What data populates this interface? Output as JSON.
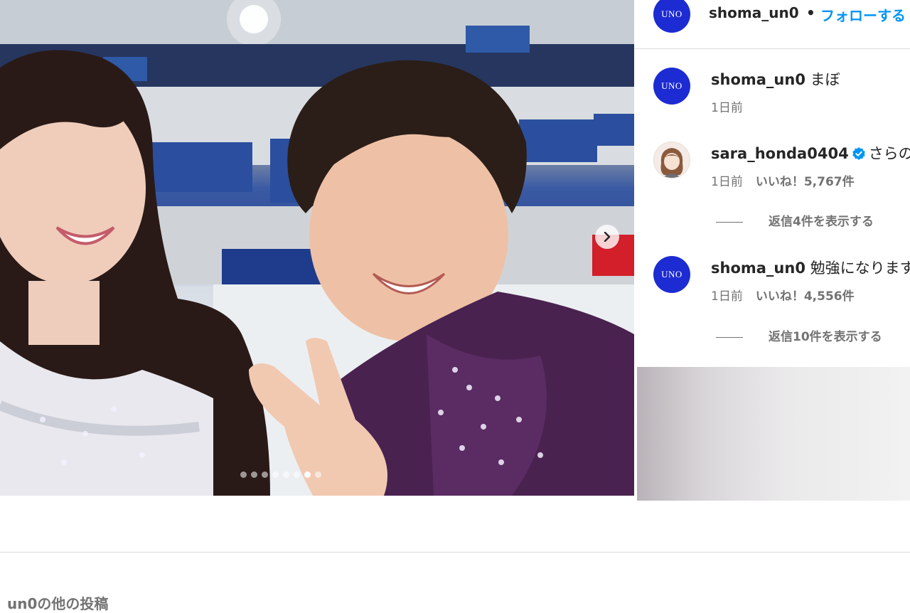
{
  "post": {
    "image_alt": "",
    "carousel": {
      "total": 8,
      "active_index": 6
    }
  },
  "header": {
    "avatar_text": "UNO",
    "username": "shoma_un0",
    "separator": "•",
    "follow_label": "フォローする"
  },
  "comments": [
    {
      "avatar_text": "UNO",
      "username": "shoma_un0",
      "text": "まぼ",
      "time": "1日前",
      "likes": "",
      "replies": ""
    },
    {
      "avatar_text": "",
      "username": "sara_honda0404",
      "verified": true,
      "text": "さらの",
      "time": "1日前",
      "likes": "いいね！5,767件",
      "replies": "返信4件を表示する"
    },
    {
      "avatar_text": "UNO",
      "username": "shoma_un0",
      "text": "勉強になります",
      "time": "1日前",
      "likes": "いいね！4,556件",
      "replies": "返信10件を表示する"
    }
  ],
  "more_posts": {
    "label": "un0の他の投稿"
  },
  "colors": {
    "accent": "#0095f6",
    "uno_avatar": "#1d2bd3",
    "muted": "#737373"
  },
  "icons": {
    "next": "chevron-right-icon",
    "verified": "verified-badge-icon"
  }
}
